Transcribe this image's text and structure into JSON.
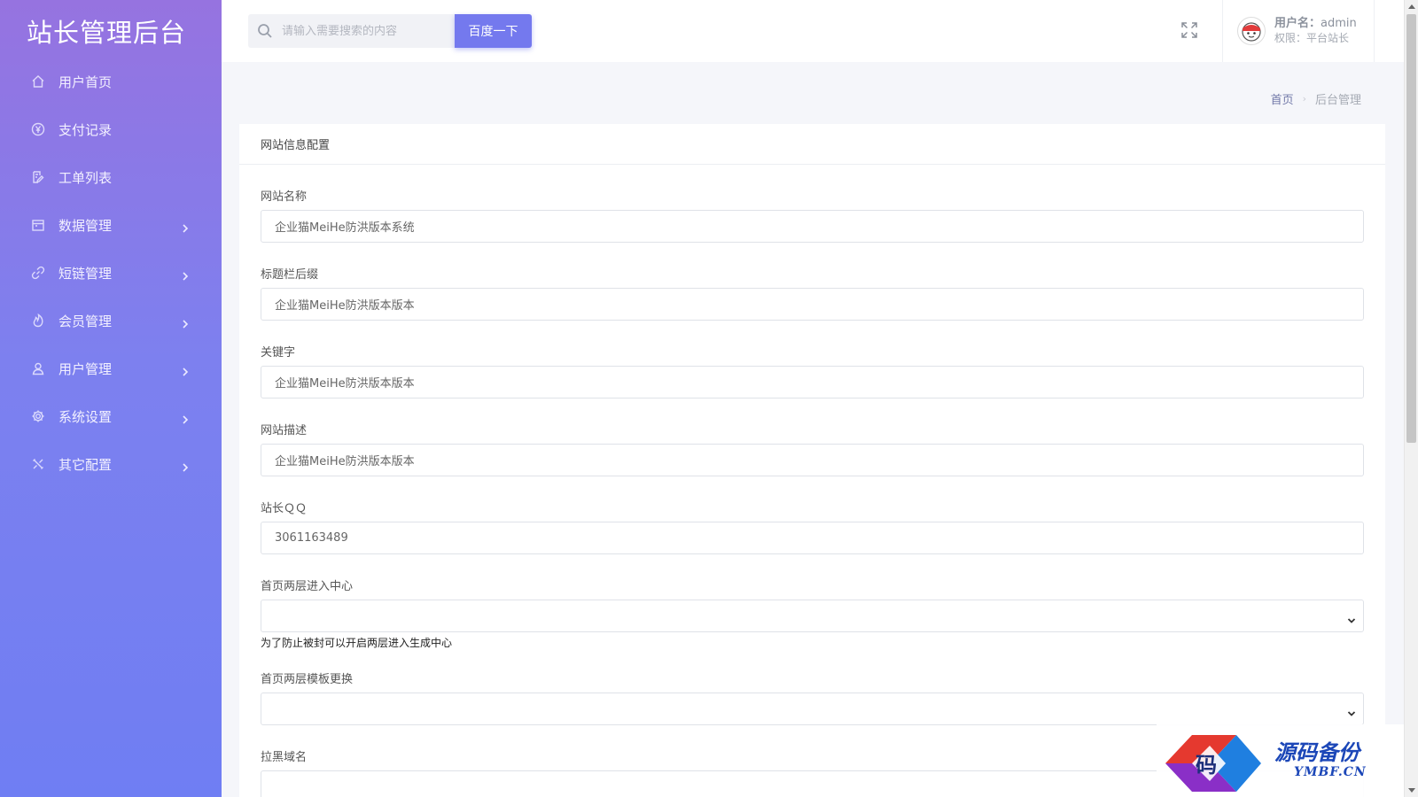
{
  "sidebar": {
    "brand": "站长管理后台",
    "items": [
      {
        "label": "用户首页",
        "icon": "home-icon",
        "has_arrow": false
      },
      {
        "label": "支付记录",
        "icon": "yen-icon",
        "has_arrow": false
      },
      {
        "label": "工单列表",
        "icon": "edit-icon",
        "has_arrow": false
      },
      {
        "label": "数据管理",
        "icon": "calendar-icon",
        "has_arrow": true
      },
      {
        "label": "短链管理",
        "icon": "link-icon",
        "has_arrow": true
      },
      {
        "label": "会员管理",
        "icon": "fire-icon",
        "has_arrow": true
      },
      {
        "label": "用户管理",
        "icon": "user-icon",
        "has_arrow": true
      },
      {
        "label": "系统设置",
        "icon": "gear-icon",
        "has_arrow": true
      },
      {
        "label": "其它配置",
        "icon": "tools-icon",
        "has_arrow": true
      }
    ],
    "gradient": [
      "#9673e0",
      "#6f7ef3"
    ]
  },
  "topbar": {
    "search_placeholder": "请输入需要搜索的内容",
    "search_button": "百度一下",
    "user_label": "用户名：",
    "user_name": "admin",
    "role_label": "权限：平台站长",
    "accent": "#7479ee"
  },
  "breadcrumb": {
    "home": "首页",
    "separator": "›",
    "current": "后台管理"
  },
  "card": {
    "title": "网站信息配置",
    "fields": [
      {
        "label": "网站名称",
        "type": "text",
        "value": "企业猫MeiHe防洪版本系统"
      },
      {
        "label": "标题栏后缀",
        "type": "text",
        "value": "企业猫MeiHe防洪版本版本"
      },
      {
        "label": "关键字",
        "type": "text",
        "value": "企业猫MeiHe防洪版本版本"
      },
      {
        "label": "网站描述",
        "type": "text",
        "value": "企业猫MeiHe防洪版本版本"
      },
      {
        "label": "站长ＱＱ",
        "type": "text",
        "value": "3061163489"
      },
      {
        "label": "首页两层进入中心",
        "type": "select",
        "value": "",
        "help": "为了防止被封可以开启两层进入生成中心"
      },
      {
        "label": "首页两层模板更换",
        "type": "select",
        "value": ""
      },
      {
        "label": "拉黑域名",
        "type": "text",
        "value": ""
      }
    ]
  },
  "watermark": {
    "logo_char": "码",
    "title": "源码备份",
    "subtitle": "YMBF.CN"
  }
}
